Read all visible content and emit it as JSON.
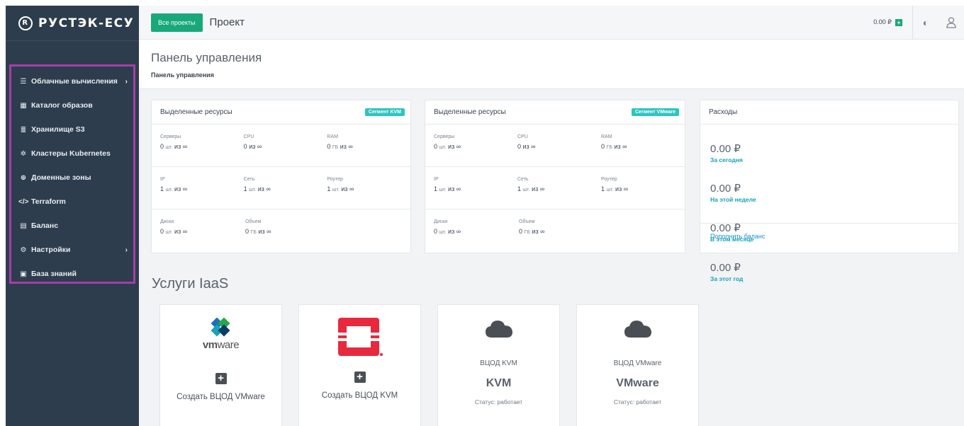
{
  "brand": {
    "logo_text": "РУСТЭК-ЕСУ"
  },
  "sidebar": {
    "items": [
      {
        "label": "Облачные вычисления",
        "icon": "server-icon",
        "has_arrow": true
      },
      {
        "label": "Каталог образов",
        "icon": "grid-icon",
        "has_arrow": false
      },
      {
        "label": "Хранилище S3",
        "icon": "database-icon",
        "has_arrow": false
      },
      {
        "label": "Кластеры Kubernetes",
        "icon": "helm-icon",
        "has_arrow": false
      },
      {
        "label": "Доменные зоны",
        "icon": "globe-icon",
        "has_arrow": false
      },
      {
        "label": "Terraform",
        "icon": "code-icon",
        "has_arrow": false
      },
      {
        "label": "Баланс",
        "icon": "wallet-icon",
        "has_arrow": false
      },
      {
        "label": "Настройки",
        "icon": "gears-icon",
        "has_arrow": true
      },
      {
        "label": "База знаний",
        "icon": "book-icon",
        "has_arrow": false
      }
    ]
  },
  "topbar": {
    "projects_button": "Все проекты",
    "project_title": "Проект",
    "balance": "0.00 ₽"
  },
  "page": {
    "title": "Панель управления",
    "breadcrumb": "Панель управления"
  },
  "resources": [
    {
      "title": "Выделенные ресурсы",
      "badge": "Сегмент KVM",
      "rows": [
        [
          {
            "label": "Серверы",
            "num": "0",
            "unit": "шт.",
            "of": "из ∞"
          },
          {
            "label": "CPU",
            "num": "0",
            "unit": "",
            "of": "из ∞"
          },
          {
            "label": "RAM",
            "num": "0",
            "unit": "ГБ",
            "of": "из ∞"
          }
        ],
        [
          {
            "label": "IP",
            "num": "1",
            "unit": "шт.",
            "of": "из ∞"
          },
          {
            "label": "Сеть",
            "num": "1",
            "unit": "шт.",
            "of": "из ∞"
          },
          {
            "label": "Роутер",
            "num": "1",
            "unit": "шт.",
            "of": "из ∞"
          }
        ],
        [
          {
            "label": "Диски",
            "num": "0",
            "unit": "шт.",
            "of": "из ∞"
          },
          {
            "label": "Объем",
            "num": "0",
            "unit": "ГБ",
            "of": "из ∞"
          }
        ]
      ]
    },
    {
      "title": "Выделенные ресурсы",
      "badge": "Сегмент VMware",
      "rows": [
        [
          {
            "label": "Серверы",
            "num": "0",
            "unit": "шт.",
            "of": "из ∞"
          },
          {
            "label": "CPU",
            "num": "0",
            "unit": "",
            "of": "из ∞"
          },
          {
            "label": "RAM",
            "num": "0",
            "unit": "ГБ",
            "of": "из ∞"
          }
        ],
        [
          {
            "label": "IP",
            "num": "1",
            "unit": "шт.",
            "of": "из ∞"
          },
          {
            "label": "Сеть",
            "num": "1",
            "unit": "шт.",
            "of": "из ∞"
          },
          {
            "label": "Роутер",
            "num": "1",
            "unit": "шт.",
            "of": "из ∞"
          }
        ],
        [
          {
            "label": "Диски",
            "num": "0",
            "unit": "шт.",
            "of": "из ∞"
          },
          {
            "label": "Объем",
            "num": "0",
            "unit": "ГБ",
            "of": "из ∞"
          }
        ]
      ]
    }
  ],
  "expenses": {
    "title": "Расходы",
    "items": [
      {
        "amount": "0.00 ₽",
        "period": "За сегодня"
      },
      {
        "amount": "0.00 ₽",
        "period": "На этой неделе"
      },
      {
        "amount": "0.00 ₽",
        "period": "В этом месяце"
      },
      {
        "amount": "0.00 ₽",
        "period": "За этот год"
      }
    ],
    "topup_link": "Пополнить баланс"
  },
  "iaas": {
    "title": "Услуги IaaS",
    "cards": [
      {
        "kind": "create",
        "logo": "vmware-logo",
        "label": "Создать ВЦОД VMware"
      },
      {
        "kind": "create",
        "logo": "openstack-logo",
        "label": "Создать ВЦОД KVM"
      },
      {
        "kind": "status",
        "name": "ВЦОД KVM",
        "big": "KVM",
        "status": "Статус: работает"
      },
      {
        "kind": "status",
        "name": "ВЦОД VMware",
        "big": "VMware",
        "status": "Статус: работает"
      }
    ]
  },
  "colors": {
    "sidebar": "#2e3d4d",
    "accent": "#18a87a",
    "badge": "#2ec4c0",
    "highlight": "#a43ea9",
    "link": "#1a8fd6"
  }
}
